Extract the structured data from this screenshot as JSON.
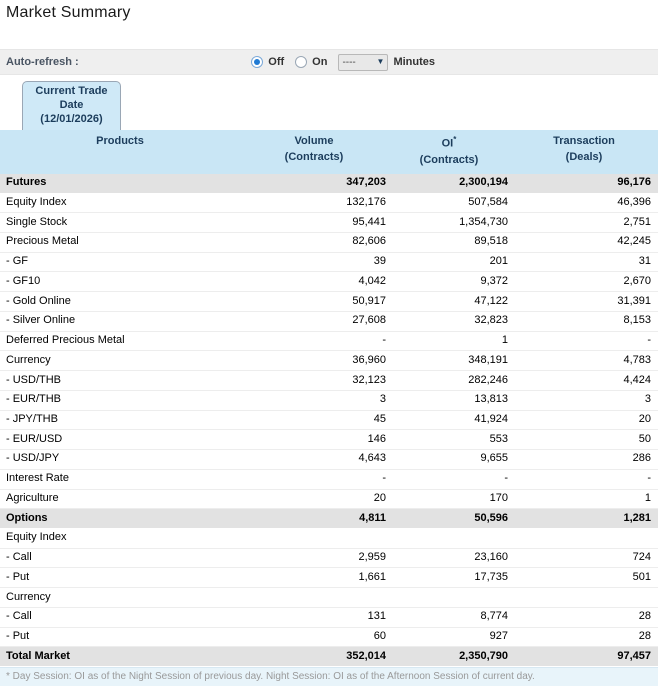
{
  "page": {
    "title": "Market Summary"
  },
  "autorefresh": {
    "label": "Auto-refresh :",
    "off_label": "Off",
    "on_label": "On",
    "select_value": "----",
    "minutes_label": "Minutes"
  },
  "tab": {
    "line1": "Current Trade Date",
    "line2": "(12/01/2026)"
  },
  "table": {
    "headers": {
      "products": "Products",
      "volume_line1": "Volume",
      "volume_line2": "(Contracts)",
      "oi_line1": "OI",
      "oi_sup": "*",
      "oi_line2": "(Contracts)",
      "transaction_line1": "Transaction",
      "transaction_line2": "(Deals)"
    },
    "rows": [
      {
        "label": "Futures",
        "volume": "347,203",
        "oi": "2,300,194",
        "deals": "96,176",
        "type": "section"
      },
      {
        "label": "Equity Index",
        "volume": "132,176",
        "oi": "507,584",
        "deals": "46,396",
        "type": "item"
      },
      {
        "label": "Single Stock",
        "volume": "95,441",
        "oi": "1,354,730",
        "deals": "2,751",
        "type": "item"
      },
      {
        "label": "Precious Metal",
        "volume": "82,606",
        "oi": "89,518",
        "deals": "42,245",
        "type": "item"
      },
      {
        "label": "- GF",
        "volume": "39",
        "oi": "201",
        "deals": "31",
        "type": "item"
      },
      {
        "label": "- GF10",
        "volume": "4,042",
        "oi": "9,372",
        "deals": "2,670",
        "type": "item"
      },
      {
        "label": "- Gold Online",
        "volume": "50,917",
        "oi": "47,122",
        "deals": "31,391",
        "type": "item"
      },
      {
        "label": "- Silver Online",
        "volume": "27,608",
        "oi": "32,823",
        "deals": "8,153",
        "type": "item"
      },
      {
        "label": "Deferred Precious Metal",
        "volume": "-",
        "oi": "1",
        "deals": "-",
        "type": "item"
      },
      {
        "label": "Currency",
        "volume": "36,960",
        "oi": "348,191",
        "deals": "4,783",
        "type": "item"
      },
      {
        "label": "- USD/THB",
        "volume": "32,123",
        "oi": "282,246",
        "deals": "4,424",
        "type": "item"
      },
      {
        "label": "- EUR/THB",
        "volume": "3",
        "oi": "13,813",
        "deals": "3",
        "type": "item"
      },
      {
        "label": "- JPY/THB",
        "volume": "45",
        "oi": "41,924",
        "deals": "20",
        "type": "item"
      },
      {
        "label": "- EUR/USD",
        "volume": "146",
        "oi": "553",
        "deals": "50",
        "type": "item"
      },
      {
        "label": "- USD/JPY",
        "volume": "4,643",
        "oi": "9,655",
        "deals": "286",
        "type": "item"
      },
      {
        "label": "Interest Rate",
        "volume": "-",
        "oi": "-",
        "deals": "-",
        "type": "item"
      },
      {
        "label": "Agriculture",
        "volume": "20",
        "oi": "170",
        "deals": "1",
        "type": "item"
      },
      {
        "label": "Options",
        "volume": "4,811",
        "oi": "50,596",
        "deals": "1,281",
        "type": "section"
      },
      {
        "label": "Equity Index",
        "volume": "",
        "oi": "",
        "deals": "",
        "type": "group"
      },
      {
        "label": "- Call",
        "volume": "2,959",
        "oi": "23,160",
        "deals": "724",
        "type": "item"
      },
      {
        "label": "- Put",
        "volume": "1,661",
        "oi": "17,735",
        "deals": "501",
        "type": "item"
      },
      {
        "label": "Currency",
        "volume": "",
        "oi": "",
        "deals": "",
        "type": "group"
      },
      {
        "label": "- Call",
        "volume": "131",
        "oi": "8,774",
        "deals": "28",
        "type": "item"
      },
      {
        "label": "- Put",
        "volume": "60",
        "oi": "927",
        "deals": "28",
        "type": "item"
      },
      {
        "label": "Total Market",
        "volume": "352,014",
        "oi": "2,350,790",
        "deals": "97,457",
        "type": "total"
      }
    ]
  },
  "footnote": "* Day Session: OI as of the Night Session of previous day. Night Session: OI as of the Afternoon Session of current day.",
  "colors": {
    "header_bg": "#c9e6f5",
    "tab_bg": "#cfe9f7",
    "header_text": "#1c3d5c",
    "section_row_bg": "#e2e2e2",
    "autorefresh_bar_bg": "#efefef",
    "radio_selected": "#1f7ad4",
    "footnote_bg": "#e8f4fa",
    "footnote_text": "#999999"
  }
}
